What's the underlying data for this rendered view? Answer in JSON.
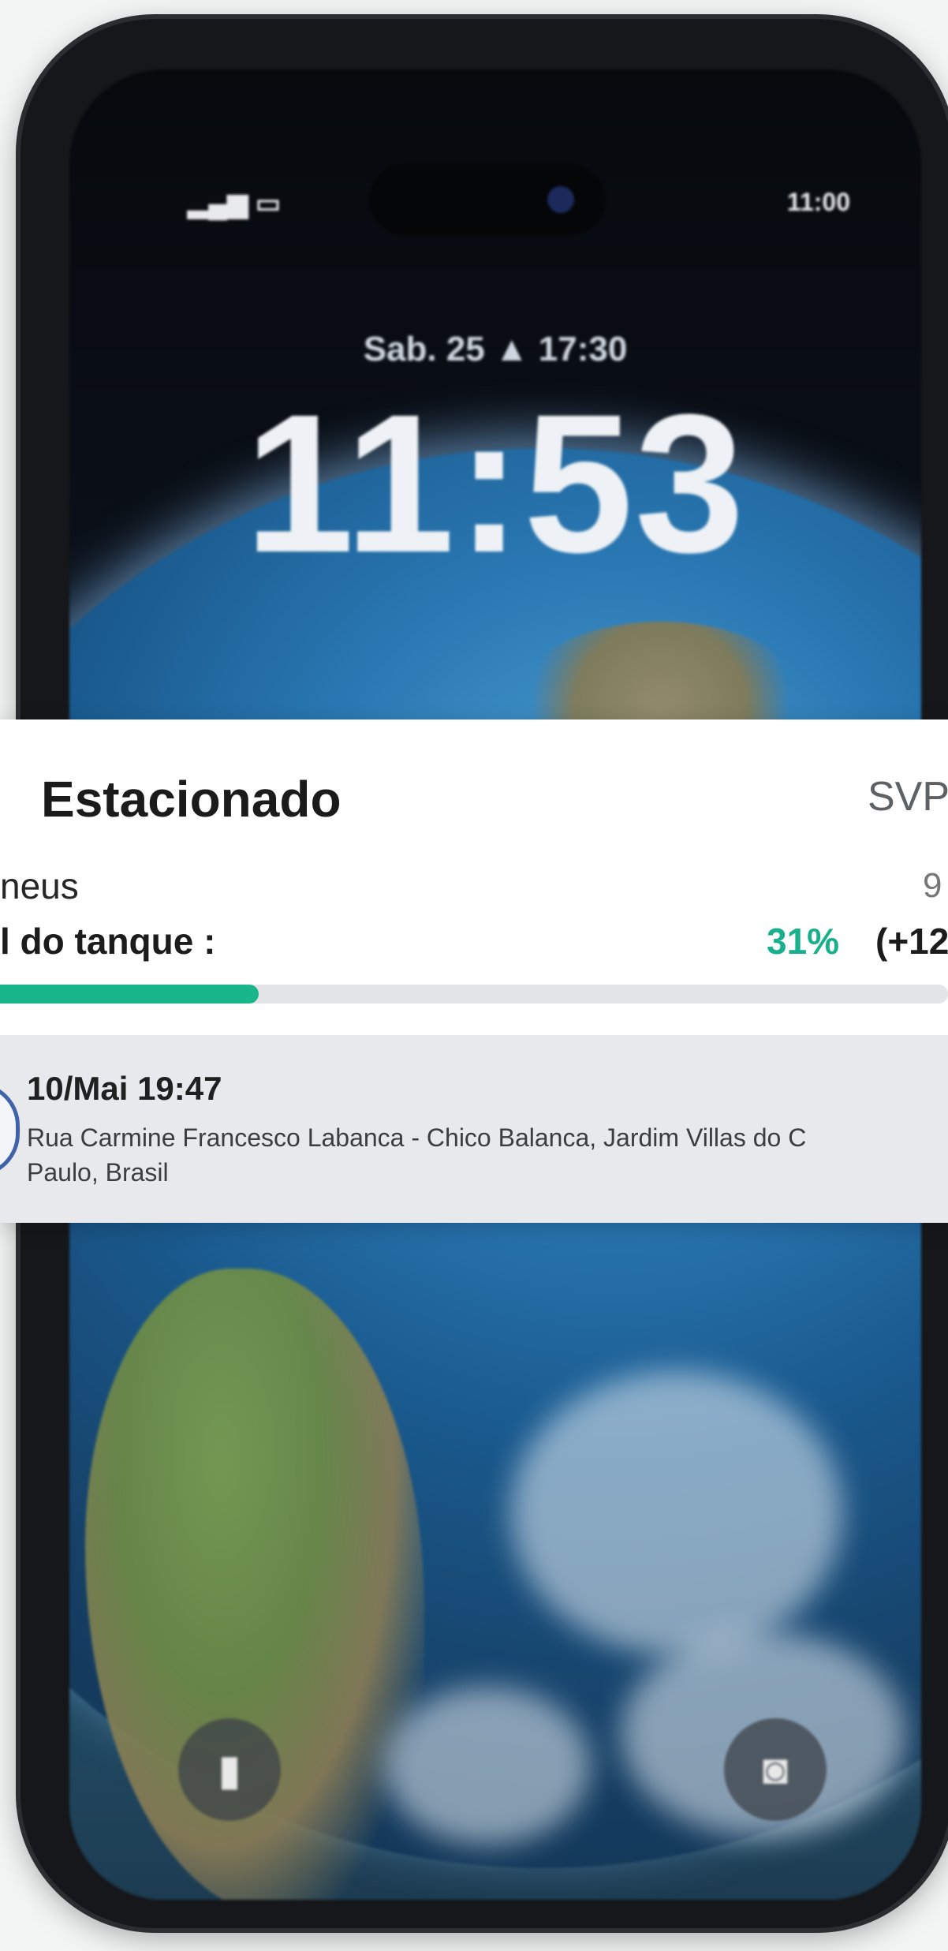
{
  "lockscreen": {
    "signal_icon": "cellular-signal-icon",
    "status_right": "11:00",
    "date_line": "Sab. 25 ▲ 17:30",
    "time": "11:53",
    "flashlight_icon": "flashlight-icon",
    "camera_icon": "camera-icon"
  },
  "notification": {
    "title": "Estacionado",
    "plate": "SVP",
    "tires_label": "neus",
    "tires_value": "9",
    "tank_label": "l do tanque :",
    "tank_percent": "31%",
    "tank_delta": "(+12",
    "fuel_level": 0.31,
    "event": {
      "time": "10/Mai 19:47",
      "address": "Rua Carmine Francesco Labanca - Chico Balanca, Jardim Villas do C\nPaulo, Brasil"
    }
  },
  "colors": {
    "accent": "#19b58b",
    "card_bg": "#ffffff",
    "event_bg": "#e7e9ec"
  }
}
